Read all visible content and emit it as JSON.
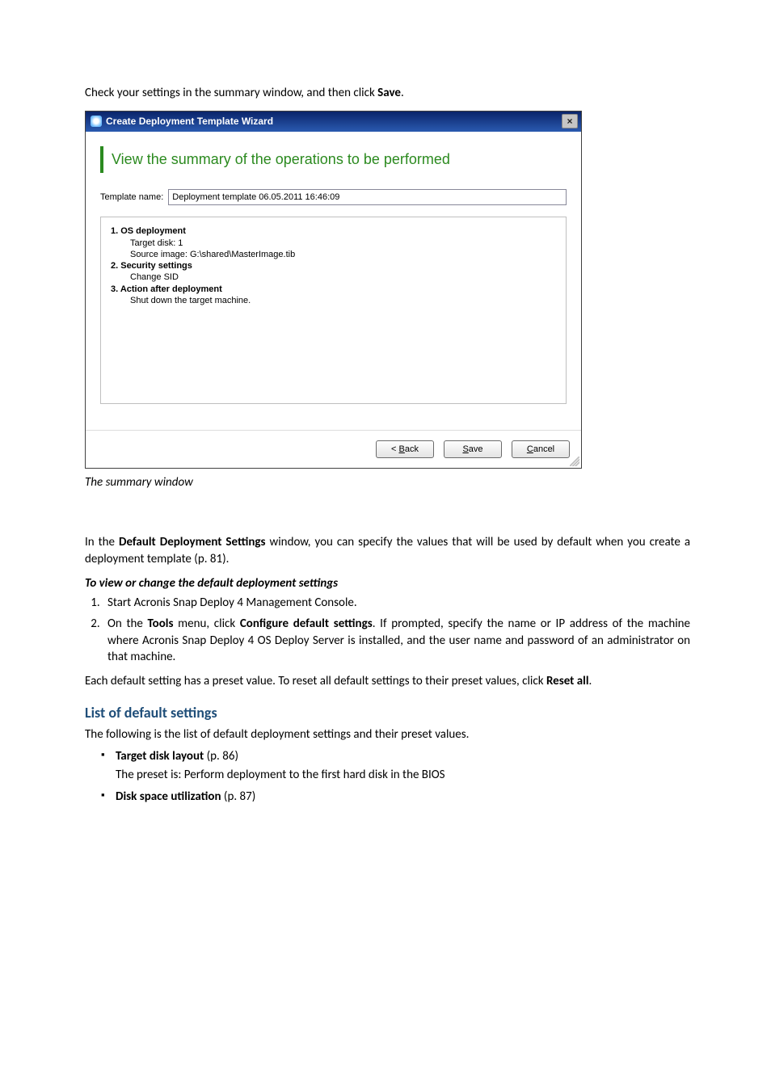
{
  "intro": {
    "prefix": "Check your settings in the summary window, and then click ",
    "save_word": "Save",
    "suffix": "."
  },
  "window": {
    "title": "Create Deployment Template Wizard",
    "close": "×",
    "heading": "View the summary of the operations to be performed",
    "template_label": "Template name:",
    "template_value": "Deployment template 06.05.2011 16:46:09",
    "summary": {
      "s1": "1. OS deployment",
      "s1a": "Target disk: 1",
      "s1b": "Source image: G:\\shared\\MasterImage.tib",
      "s2": "2. Security settings",
      "s2a": "Change SID",
      "s3": "3. Action after deployment",
      "s3a": "Shut down the target machine."
    },
    "buttons": {
      "back": "< Back",
      "save": "Save",
      "cancel": "Cancel"
    },
    "mnemonics": {
      "back_u": "B",
      "save_u": "S",
      "cancel_u": "C"
    }
  },
  "caption": "The summary window",
  "para2": {
    "a": "In the ",
    "b": "Default Deployment Settings",
    "c": " window, you can specify the values that will be used by default when you create a deployment template (p. 81)."
  },
  "h_view": "To view or change the default deployment settings",
  "list1": {
    "i1": "Start Acronis Snap Deploy 4 Management Console.",
    "i2a": "On the ",
    "i2b": "Tools",
    "i2c": " menu, click ",
    "i2d": "Configure default settings",
    "i2e": ". If prompted, specify the name or IP address of the machine where Acronis Snap Deploy 4 OS Deploy Server is installed, and the user name and password of an administrator on that machine."
  },
  "para3": {
    "a": "Each default setting has a preset value. To reset all default settings to their preset values, click ",
    "b": "Reset all",
    "c": "."
  },
  "h_list": "List of default settings",
  "para4": "The following is the list of default deployment settings and their preset values.",
  "bullets": {
    "b1_label": "Target disk layout",
    "b1_ref": " (p. 86)",
    "b1_preset": "The preset is: Perform deployment to the first hard disk in the BIOS",
    "b2_label": "Disk space utilization",
    "b2_ref": " (p. 87)"
  }
}
